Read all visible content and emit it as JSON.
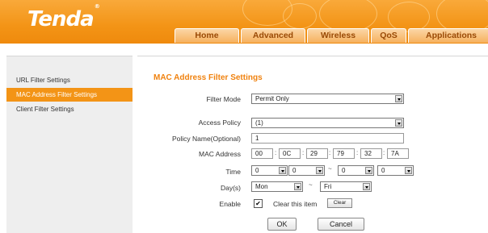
{
  "header": {
    "logo": "Tenda",
    "logo_mark": "®",
    "tabs": [
      {
        "label": "Home"
      },
      {
        "label": "Advanced"
      },
      {
        "label": "Wireless"
      },
      {
        "label": "QoS"
      },
      {
        "label": "Applications"
      }
    ]
  },
  "sidebar": {
    "items": [
      {
        "label": "URL Filter Settings"
      },
      {
        "label": "MAC Address Filter Settings"
      },
      {
        "label": "Client Filter Settings"
      }
    ],
    "active_index": 1
  },
  "form": {
    "title": "MAC Address Filter Settings",
    "filter_mode": {
      "label": "Filter Mode",
      "value": "Permit Only"
    },
    "access_policy": {
      "label": "Access Policy",
      "value": "(1)"
    },
    "policy_name": {
      "label": "Policy Name(Optional)",
      "value": "1"
    },
    "mac": {
      "label": "MAC Address",
      "octets": [
        "00",
        "0C",
        "29",
        "79",
        "32",
        "7A"
      ],
      "separator": ":"
    },
    "time": {
      "label": "Time",
      "values": [
        "0",
        "0",
        "0",
        "0"
      ],
      "range_separator": "~"
    },
    "days": {
      "label": "Day(s)",
      "from": "Mon",
      "to": "Fri",
      "range_separator": "~"
    },
    "enable": {
      "label": "Enable",
      "checked": true,
      "check_mark": "✔",
      "clear_text": "Clear this item",
      "clear_button": "Clear"
    },
    "ok_label": "OK",
    "cancel_label": "Cancel"
  },
  "colors": {
    "brand": "#f39416",
    "title": "#f0820f",
    "sidebar_bg": "#eeeeee"
  }
}
